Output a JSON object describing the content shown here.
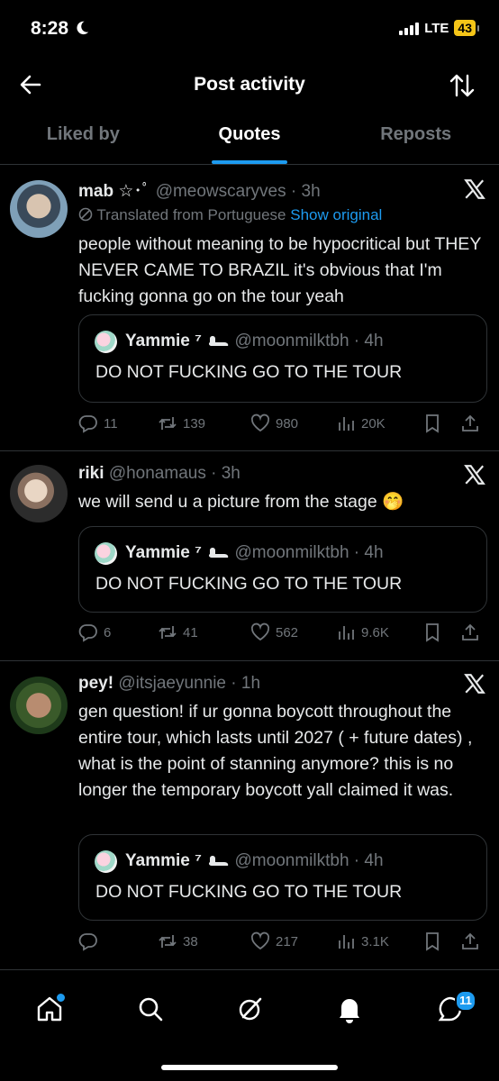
{
  "status_bar": {
    "time": "8:28",
    "network": "LTE",
    "battery": "43"
  },
  "header": {
    "title": "Post activity"
  },
  "tabs": [
    {
      "label": "Liked by"
    },
    {
      "label": "Quotes"
    },
    {
      "label": "Reposts"
    }
  ],
  "posts": [
    {
      "name": "mab",
      "name_deco": "☆･ﾟ",
      "handle": "@meowscaryves",
      "time": "3h",
      "translated_label": "Translated from Portuguese",
      "show_original": "Show original",
      "text": "people without meaning to be hypocritical but THEY NEVER CAME TO BRAZIL it's obvious that I'm fucking gonna go on the tour yeah",
      "quote": {
        "name": "Yammie ⁷",
        "handle": "@moonmilktbh",
        "time": "4h",
        "text": "DO NOT FUCKING GO TO THE TOUR"
      },
      "replies": "11",
      "reposts": "139",
      "likes": "980",
      "views": "20K"
    },
    {
      "name": "riki",
      "handle": "@honamaus",
      "time": "3h",
      "text": "we will send u a picture from the stage 🤭",
      "quote": {
        "name": "Yammie ⁷",
        "handle": "@moonmilktbh",
        "time": "4h",
        "text": "DO NOT FUCKING GO TO THE TOUR"
      },
      "replies": "6",
      "reposts": "41",
      "likes": "562",
      "views": "9.6K"
    },
    {
      "name": "pey!",
      "handle": "@itsjaeyunnie",
      "time": "1h",
      "text": "gen question! if ur gonna boycott throughout the entire tour, which lasts until 2027 ( + future dates) , what is the point of stanning anymore? this is no longer the temporary boycott yall claimed it was.",
      "quote": {
        "name": "Yammie ⁷",
        "handle": "@moonmilktbh",
        "time": "4h",
        "text": "DO NOT FUCKING GO TO THE TOUR"
      },
      "replies": "",
      "reposts": "38",
      "likes": "217",
      "views": "3.1K"
    }
  ],
  "nav": {
    "messages_badge": "11"
  },
  "colors": {
    "accent": "#1d9bf0",
    "muted": "#71767b",
    "border": "#2f3336"
  },
  "icons": [
    "back-arrow-icon",
    "sort-icon",
    "x-logo-icon",
    "translate-icon",
    "reply-icon",
    "repost-icon",
    "like-icon",
    "views-icon",
    "bookmark-icon",
    "share-icon",
    "home-icon",
    "search-icon",
    "grok-icon",
    "notifications-icon",
    "messages-icon"
  ]
}
